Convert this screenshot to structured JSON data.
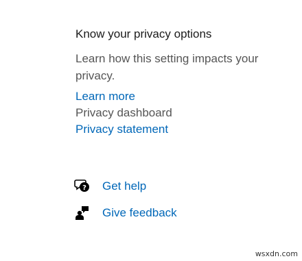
{
  "privacy": {
    "title": "Know your privacy options",
    "description": "Learn how this setting impacts your privacy.",
    "learn_more": "Learn more",
    "dashboard": "Privacy dashboard",
    "statement": "Privacy statement"
  },
  "support": {
    "get_help": "Get help",
    "give_feedback": "Give feedback",
    "get_help_icon": "chat-help-icon",
    "give_feedback_icon": "feedback-person-icon"
  },
  "watermark": "wsxdn.com",
  "colors": {
    "link": "#0067b8",
    "text": "#1a1a1a",
    "muted": "#555555"
  }
}
